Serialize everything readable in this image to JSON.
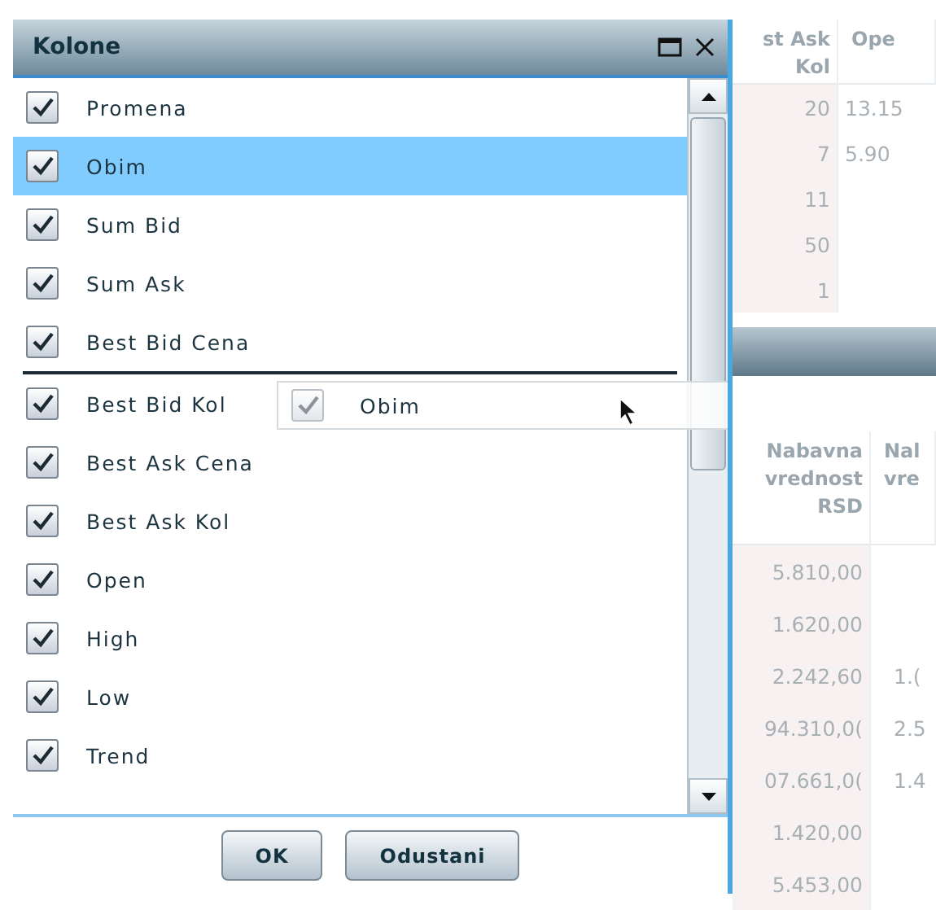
{
  "dialog": {
    "title": "Kolone",
    "items": [
      {
        "label": "Promena",
        "checked": true,
        "selected": false
      },
      {
        "label": "Obim",
        "checked": true,
        "selected": true
      },
      {
        "label": "Sum Bid",
        "checked": true,
        "selected": false
      },
      {
        "label": "Sum Ask",
        "checked": true,
        "selected": false
      },
      {
        "label": "Best Bid Cena",
        "checked": true,
        "selected": false,
        "drop_below": true
      },
      {
        "label": "Best Bid Kol",
        "checked": true,
        "selected": false
      },
      {
        "label": "Best Ask Cena",
        "checked": true,
        "selected": false
      },
      {
        "label": "Best Ask Kol",
        "checked": true,
        "selected": false
      },
      {
        "label": "Open",
        "checked": true,
        "selected": false
      },
      {
        "label": "High",
        "checked": true,
        "selected": false
      },
      {
        "label": "Low",
        "checked": true,
        "selected": false
      },
      {
        "label": "Trend",
        "checked": true,
        "selected": false
      }
    ],
    "drag_ghost": {
      "label": "Obim",
      "checked": true
    },
    "buttons": [
      "OK",
      "Odustani"
    ]
  },
  "table_top": {
    "columns": [
      "st Ask\nKol",
      "Ope"
    ],
    "rows": [
      [
        "20",
        "13.15"
      ],
      [
        "7",
        "5.90"
      ],
      [
        "11",
        ""
      ],
      [
        "50",
        ""
      ],
      [
        "1",
        ""
      ]
    ]
  },
  "table_bottom": {
    "columns": [
      "Nabavna\nvrednost\nRSD",
      "Nal\nvre"
    ],
    "rows": [
      [
        "5.810,00",
        ""
      ],
      [
        "1.620,00",
        ""
      ],
      [
        "2.242,60",
        "1.("
      ],
      [
        "94.310,0(",
        "2.5"
      ],
      [
        "07.661,0(",
        "1.4"
      ],
      [
        "1.420,00",
        ""
      ],
      [
        "5.453,00",
        ""
      ]
    ]
  }
}
